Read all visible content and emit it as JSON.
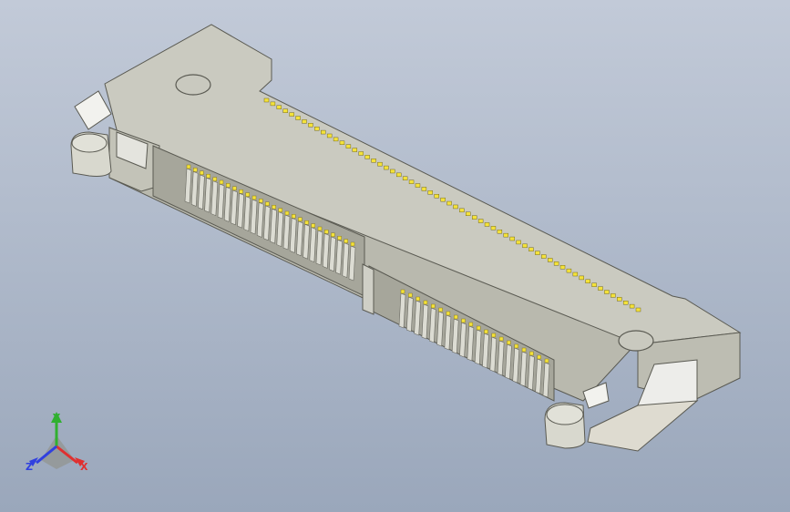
{
  "viewport": {
    "background_top": "#c2cad8",
    "background_bottom": "#9aa7bb"
  },
  "model": {
    "body_color": "#c8c8be",
    "top_face_color": "#cacac0",
    "shadow_color": "#8f8f86",
    "contact_color": "#f4e23a",
    "pin_count_visible_front_left": 26,
    "pin_count_visible_front_right": 20,
    "pin_count_visible_back": 60
  },
  "triad": {
    "x_label": "X",
    "y_label": "Y",
    "z_label": "Z",
    "x_color": "#e03030",
    "y_color": "#30b030",
    "z_color": "#3040e0"
  }
}
